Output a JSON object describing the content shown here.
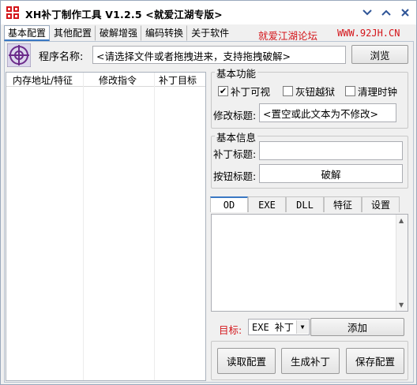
{
  "window": {
    "title": "XH补丁制作工具 V1.2.5  <就爱江湖专版>"
  },
  "tabs": [
    "基本配置",
    "其他配置",
    "破解增强",
    "编码转换",
    "关于软件"
  ],
  "promo": {
    "text1": "就爱江湖论坛",
    "text2": "WWW.92JH.CN"
  },
  "program": {
    "label": "程序名称:",
    "placeholder": "<请选择文件或者拖拽进来，支持拖拽破解>",
    "browse_label": "浏览"
  },
  "list": {
    "columns": [
      "内存地址/特征",
      "修改指令",
      "补丁目标"
    ]
  },
  "basic_function": {
    "title": "基本功能",
    "options": [
      {
        "label": "补丁可视",
        "checked": true
      },
      {
        "label": "灰钮越狱",
        "checked": false
      },
      {
        "label": "清理时钟",
        "checked": false
      }
    ],
    "modify_title_label": "修改标题:",
    "modify_title_value": "<置空或此文本为不修改>"
  },
  "basic_info": {
    "title": "基本信息",
    "patch_title_label": "补丁标题:",
    "patch_title_value": "",
    "button_title_label": "按钮标题:",
    "button_title_value": "破解"
  },
  "subtabs": [
    "OD",
    "EXE",
    "DLL",
    "特征",
    "设置"
  ],
  "target": {
    "label": "目标:",
    "selected": "EXE 补丁",
    "add_label": "添加"
  },
  "actions": {
    "read_config": "读取配置",
    "generate": "生成补丁",
    "save_config": "保存配置"
  },
  "colors": {
    "promo_red": "#d4161b",
    "accent_blue": "#3a78c3",
    "window_bg": "#f0f0f0"
  }
}
